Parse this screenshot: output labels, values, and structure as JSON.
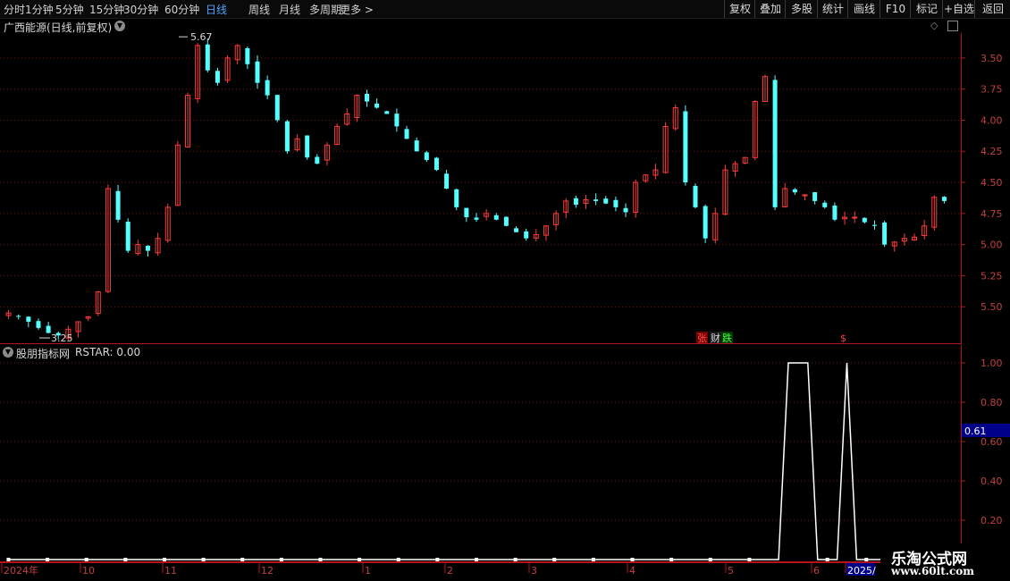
{
  "toolbar": {
    "timeframes": [
      "分时",
      "1分钟",
      "5分钟",
      "15分钟",
      "30分钟",
      "60分钟",
      "日线",
      "周线",
      "月线",
      "多周期",
      "更多 >"
    ],
    "active_timeframe": "日线",
    "right_buttons": [
      "复权",
      "叠加",
      "多股",
      "统计",
      "画线",
      "F10",
      "标记",
      "+自选",
      "返回"
    ]
  },
  "main_panel": {
    "title": "广西能源(日线,前复权)",
    "max_label": "5.67",
    "min_label": "3.25",
    "event_tags": [
      "张",
      "财",
      "跌",
      "$"
    ],
    "y_ticks": [
      "5.50",
      "5.25",
      "5.00",
      "4.75",
      "4.50",
      "4.25",
      "4.00",
      "3.75",
      "3.50"
    ]
  },
  "indicator_panel": {
    "title": "股朋指标网",
    "indicator_text": "RSTAR: 0.00",
    "current_value_badge": "0.61",
    "y_ticks": [
      "1.00",
      "0.80",
      "0.60",
      "0.40",
      "0.20"
    ]
  },
  "date_axis": {
    "labels": [
      "2024年",
      "10",
      "11",
      "12",
      "1",
      "2",
      "3",
      "4",
      "5",
      "6",
      "2025/"
    ]
  },
  "watermark": {
    "line1": "乐淘公式网",
    "line2": "www.60lt.com"
  },
  "colors": {
    "up": "#ff3b3b",
    "down": "#54ffff",
    "grid": "#7a1010",
    "axis": "#b4141e",
    "active": "#4fa3ff"
  },
  "chart_data": [
    {
      "type": "candlestick",
      "title": "广西能源(日线,前复权)",
      "ylim": [
        3.2,
        5.7
      ],
      "y_ticks": [
        3.5,
        3.75,
        4.0,
        4.25,
        4.5,
        4.75,
        5.0,
        5.25,
        5.5
      ],
      "series": [
        {
          "values": [
            3.45,
            3.42,
            3.38,
            3.33,
            3.29,
            3.27,
            3.32,
            3.38,
            3.42,
            3.62,
            4.45,
            4.2,
            3.95,
            4.0,
            3.95,
            4.05,
            4.3,
            4.8,
            5.2,
            5.6,
            5.4,
            5.3,
            5.5,
            5.6,
            5.45,
            5.3,
            5.2,
            5.0,
            4.75,
            4.85,
            4.7,
            4.65,
            4.8,
            4.95,
            5.05,
            5.2,
            5.15,
            5.1,
            5.05,
            4.95,
            4.85,
            4.75,
            4.68,
            4.6,
            4.45,
            4.3,
            4.22,
            4.2,
            4.25,
            4.2,
            4.15,
            4.1,
            4.05,
            4.08,
            4.15,
            4.25,
            4.35,
            4.32,
            4.36,
            4.35,
            4.33,
            4.3,
            4.26,
            4.5,
            4.56,
            4.6,
            4.95,
            5.1,
            4.5,
            4.3,
            4.05,
            4.25,
            4.6,
            4.65,
            4.7,
            5.15,
            5.35,
            4.3,
            4.45,
            4.42,
            4.4,
            4.35,
            4.3,
            4.2,
            4.22,
            4.22,
            4.18,
            4.15,
            4.0,
            4.02,
            4.05,
            4.06,
            4.15,
            4.38,
            4.35
          ]
        }
      ],
      "max_marker": 5.67,
      "min_marker": 3.25
    },
    {
      "type": "line",
      "title": "RSTAR",
      "ylim": [
        0,
        1.0
      ],
      "y_ticks": [
        0.2,
        0.4,
        0.6,
        0.8,
        1.0
      ],
      "series": [
        {
          "name": "RSTAR",
          "values": [
            0,
            0,
            0,
            0,
            0,
            0,
            0,
            0,
            0,
            0,
            0,
            0,
            0,
            0,
            0,
            0,
            0,
            0,
            0,
            0,
            0,
            0,
            0,
            0,
            0,
            0,
            0,
            0,
            0,
            0,
            0,
            0,
            0,
            0,
            0,
            0,
            0,
            0,
            0,
            0,
            0,
            0,
            0,
            0,
            0,
            0,
            0,
            0,
            0,
            0,
            0,
            0,
            0,
            0,
            0,
            0,
            0,
            0,
            0,
            0,
            0,
            0,
            0,
            0,
            0,
            0,
            0,
            0,
            0,
            0,
            0,
            0,
            0,
            0,
            0,
            0,
            0,
            0,
            0,
            0,
            1,
            1,
            1,
            0,
            0,
            0,
            1,
            0,
            0,
            0,
            0,
            0,
            0,
            0,
            0,
            0,
            0
          ]
        }
      ]
    }
  ]
}
